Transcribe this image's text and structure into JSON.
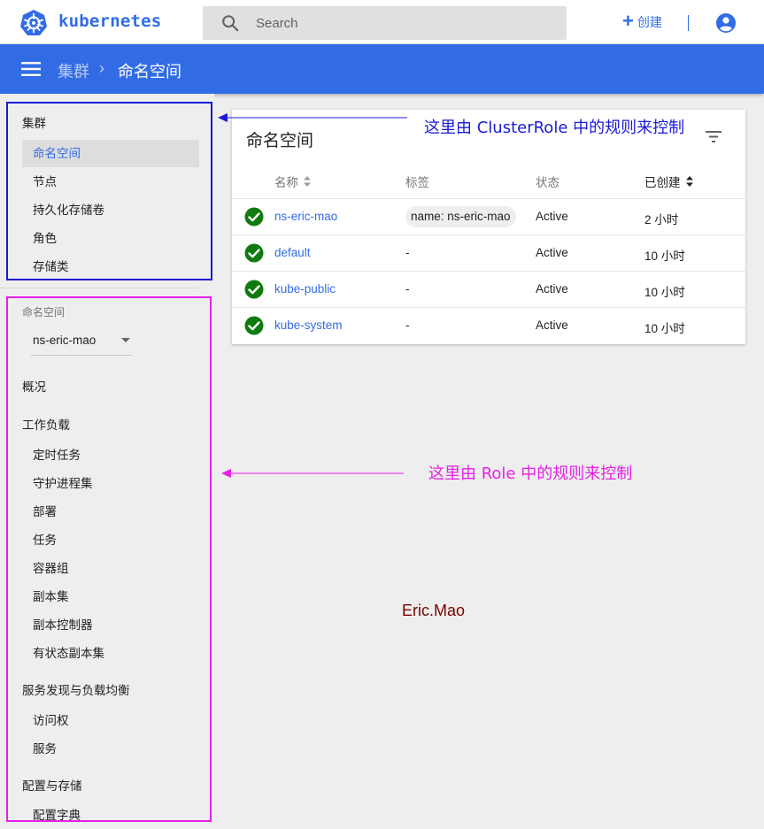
{
  "app": {
    "brand": "kubernetes",
    "search_placeholder": "Search",
    "create_label": "创建",
    "accent_color": "#326ce5"
  },
  "breadcrumb": {
    "parent": "集群",
    "separator": "›",
    "current": "命名空间"
  },
  "sidebar": {
    "cluster_header": "集群",
    "cluster_items": [
      "命名空间",
      "节点",
      "持久化存储卷",
      "角色",
      "存储类"
    ],
    "namespace_label": "命名空间",
    "namespace_selected": "ns-eric-mao",
    "overview": "概况",
    "workloads_header": "工作负载",
    "workloads_items": [
      "定时任务",
      "守护进程集",
      "部署",
      "任务",
      "容器组",
      "副本集",
      "副本控制器",
      "有状态副本集"
    ],
    "discovery_header": "服务发现与负载均衡",
    "discovery_items": [
      "访问权",
      "服务"
    ],
    "config_header": "配置与存储",
    "config_items": [
      "配置字典"
    ]
  },
  "card": {
    "title": "命名空间",
    "columns": {
      "name": "名称",
      "labels": "标签",
      "status": "状态",
      "created": "已创建"
    },
    "rows": [
      {
        "name": "ns-eric-mao",
        "label": "name: ns-eric-mao",
        "status": "Active",
        "created": "2 小时"
      },
      {
        "name": "default",
        "label": "-",
        "status": "Active",
        "created": "10 小时"
      },
      {
        "name": "kube-public",
        "label": "-",
        "status": "Active",
        "created": "10 小时"
      },
      {
        "name": "kube-system",
        "label": "-",
        "status": "Active",
        "created": "10 小时"
      }
    ]
  },
  "annotations": {
    "cluster_role_note": "这里由 ClusterRole 中的规则来控制",
    "role_note": "这里由 Role 中的规则来控制",
    "watermark": "Eric.Mao",
    "blue_color": "#1a1ad6",
    "pink_color": "#e620e6"
  }
}
